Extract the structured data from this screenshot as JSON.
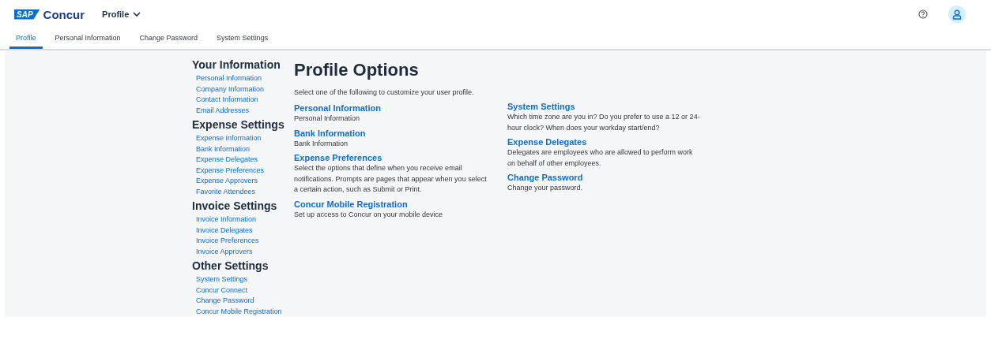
{
  "header": {
    "logo_mark": "SAP",
    "logo_text": "Concur",
    "menu": "Profile"
  },
  "tabs": [
    {
      "label": "Profile",
      "selected": true
    },
    {
      "label": "Personal Information",
      "selected": false
    },
    {
      "label": "Change Password",
      "selected": false
    },
    {
      "label": "System Settings",
      "selected": false
    }
  ],
  "sidebar": [
    {
      "heading": "Your Information",
      "links": [
        "Personal Information",
        "Company Information",
        "Contact Information",
        "Email Addresses"
      ]
    },
    {
      "heading": "Expense Settings",
      "links": [
        "Expense Information",
        "Bank Information",
        "Expense Delegates",
        "Expense Preferences",
        "Expense Approvers",
        "Favorite Attendees"
      ]
    },
    {
      "heading": "Invoice Settings",
      "links": [
        "Invoice Information",
        "Invoice Delegates",
        "Invoice Preferences",
        "Invoice Approvers"
      ]
    },
    {
      "heading": "Other Settings",
      "links": [
        "System Settings",
        "Concur Connect",
        "Change Password",
        "Concur Mobile Registration"
      ]
    }
  ],
  "main": {
    "title": "Profile Options",
    "intro": "Select one of the following to customize your user profile.",
    "columns": [
      [
        {
          "title": "Personal Information",
          "description": "Personal Information"
        },
        {
          "title": "Bank Information",
          "description": "Bank Information"
        },
        {
          "title": "Expense Preferences",
          "description": "Select the options that define when you receive email notifications. Prompts are pages that appear when you select a certain action, such as Submit or Print."
        },
        {
          "title": "Concur Mobile Registration",
          "description": "Set up access to Concur on your mobile device"
        }
      ],
      [
        {
          "title": "System Settings",
          "description": "Which time zone are you in? Do you prefer to use a 12 or 24-hour clock? When does your workday start/end?"
        },
        {
          "title": "Expense Delegates",
          "description": "Delegates are employees who are allowed to perform work on behalf of other employees."
        },
        {
          "title": "Change Password",
          "description": "Change your password."
        }
      ]
    ]
  }
}
